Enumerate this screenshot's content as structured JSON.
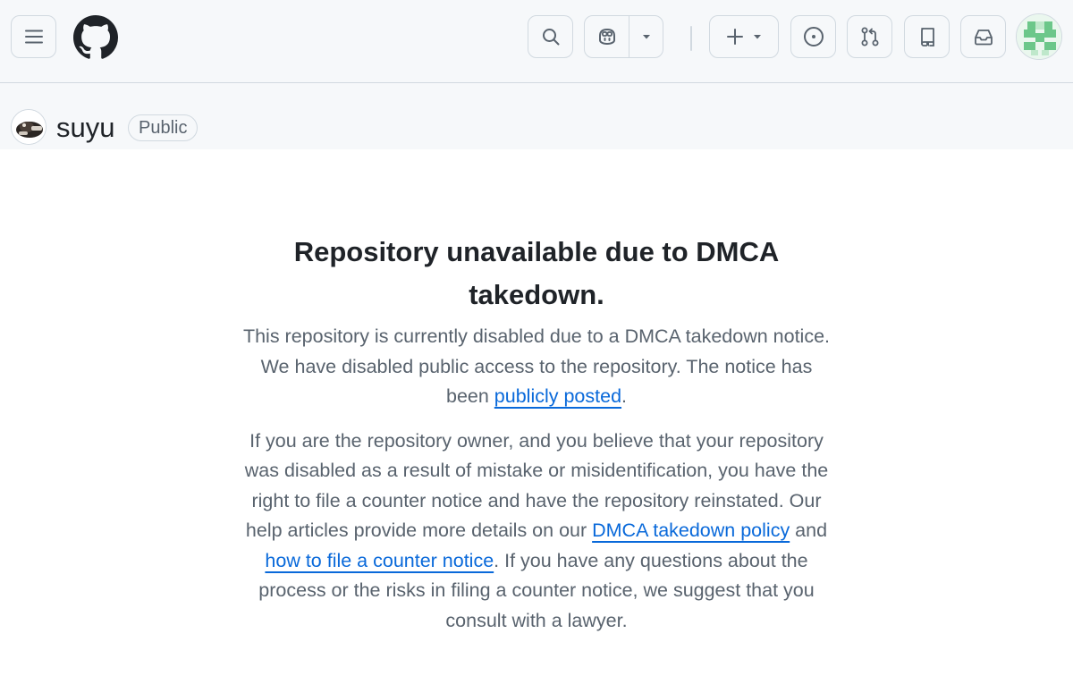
{
  "header": {
    "menu_icon": "hamburger-icon",
    "logo_icon": "github-logo-icon",
    "search_icon": "search-icon",
    "copilot_icon": "copilot-icon",
    "create_icon": "plus-icon",
    "issues_icon": "issue-opened-icon",
    "pulls_icon": "git-pull-request-icon",
    "repos_icon": "repo-icon",
    "inbox_icon": "inbox-icon",
    "avatar_icon": "identicon-avatar"
  },
  "repo": {
    "name": "suyu",
    "visibility": "Public"
  },
  "notice": {
    "title": "Repository unavailable due to DMCA takedown.",
    "p1_before": "This repository is currently disabled due to a DMCA takedown notice. We have disabled public access to the repository. The notice has been ",
    "p1_link": "publicly posted",
    "p1_after": ".",
    "p2_before": "If you are the repository owner, and you believe that your repository was disabled as a result of mistake or misidentification, you have the right to file a counter notice and have the repository reinstated. Our help articles provide more details on our ",
    "p2_link1": "DMCA takedown policy",
    "p2_mid": " and ",
    "p2_link2": "how to file a counter notice",
    "p2_after": ". If you have any questions about the process or the risks in filing a counter notice, we suggest that you consult with a lawyer."
  },
  "colors": {
    "link": "#0969da",
    "header_bg": "#f6f8fa",
    "muted_text": "#59636e",
    "border": "#d1d9e0"
  }
}
